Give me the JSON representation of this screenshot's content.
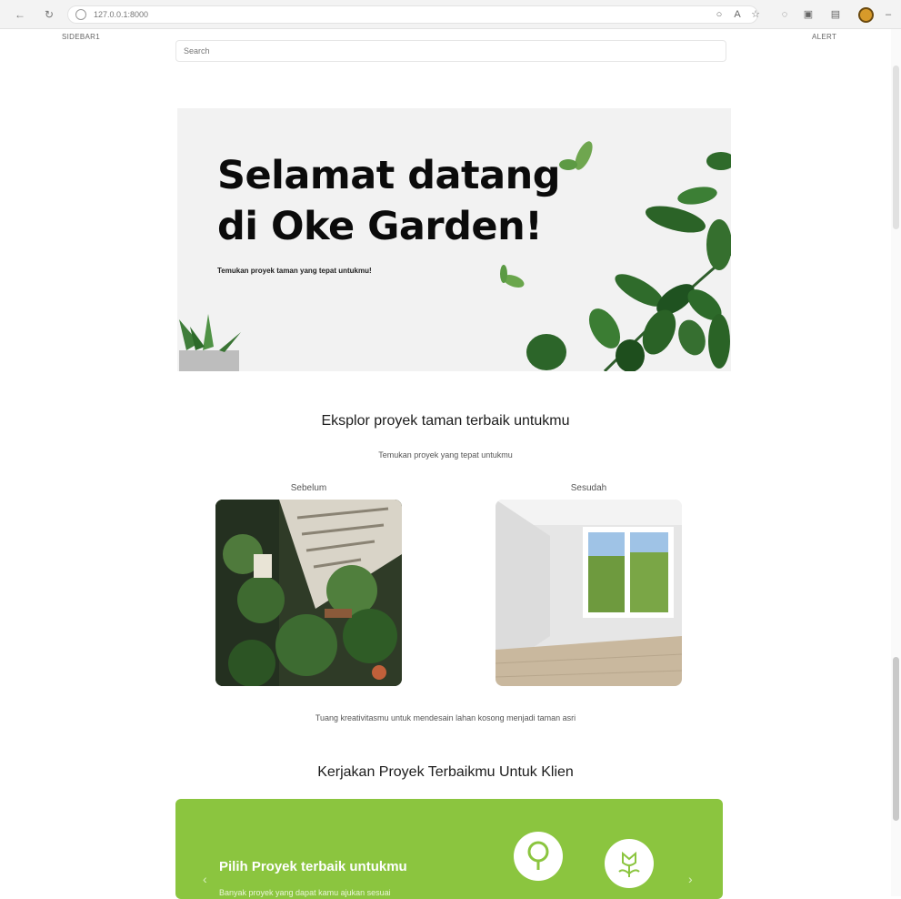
{
  "browser": {
    "url": "127.0.0.1:8000"
  },
  "nav": {
    "left_link": "SIDEBAR1",
    "right_link": "ALERT"
  },
  "search": {
    "placeholder": "Search"
  },
  "hero": {
    "title": "Selamat datang di Oke Garden!",
    "subtitle": "Temukan proyek taman yang tepat untukmu!"
  },
  "explore": {
    "title": "Eksplor proyek taman terbaik untukmu",
    "subtitle": "Temukan proyek yang tepat untukmu",
    "before_label": "Sebelum",
    "after_label": "Sesudah",
    "caption": "Tuang kreativitasmu untuk mendesain lahan kosong menjadi taman asri"
  },
  "work": {
    "title": "Kerjakan Proyek Terbaikmu Untuk Klien",
    "card_title": "Pilih Proyek terbaik untukmu",
    "card_text": "Banyak proyek yang dapat kamu ajukan sesuai"
  },
  "colors": {
    "accent_green": "#8bc53f",
    "hero_bg": "#f2f2f2"
  },
  "icons": [
    "back-icon",
    "forward-icon",
    "reload-icon",
    "info-icon",
    "tree-icon",
    "flower-icon",
    "chevron-left-icon",
    "chevron-right-icon"
  ]
}
